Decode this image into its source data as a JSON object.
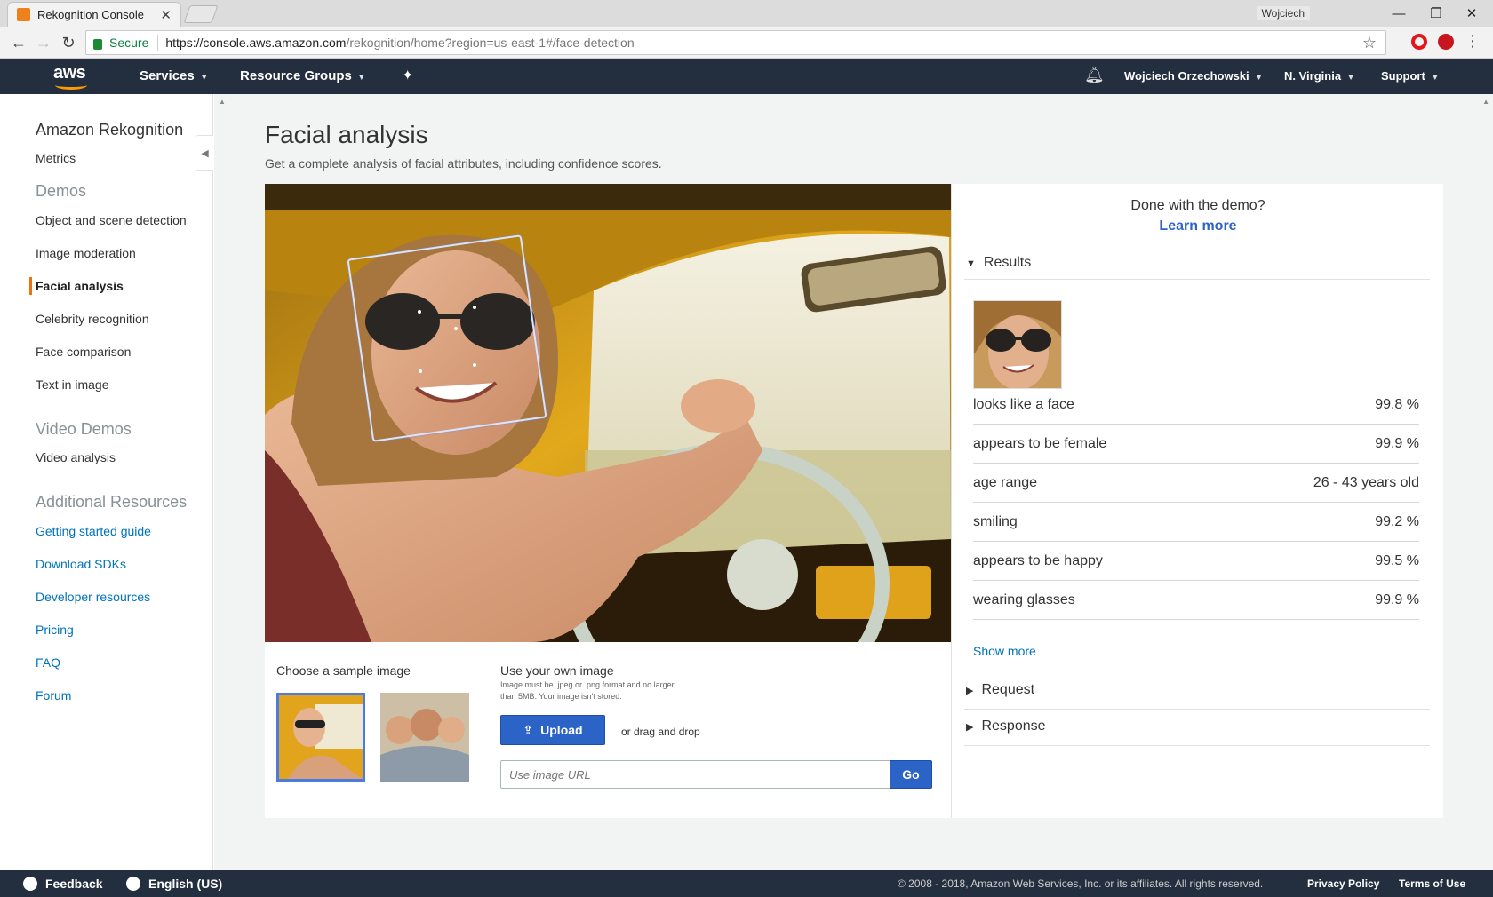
{
  "browser": {
    "tab_title": "Rekognition Console",
    "window_user": "Wojciech",
    "secure_label": "Secure",
    "url_host": "https://console.aws.amazon.com",
    "url_path": "/rekognition/home?region=us-east-1#/face-detection"
  },
  "awsnav": {
    "logo": "aws",
    "services": "Services",
    "resource_groups": "Resource Groups",
    "user": "Wojciech Orzechowski",
    "region": "N. Virginia",
    "support": "Support"
  },
  "sidebar": {
    "title": "Amazon Rekognition",
    "metrics": "Metrics",
    "demos_head": "Demos",
    "demos": [
      "Object and scene detection",
      "Image moderation",
      "Facial analysis",
      "Celebrity recognition",
      "Face comparison",
      "Text in image"
    ],
    "video_head": "Video Demos",
    "video_items": [
      "Video analysis"
    ],
    "resources_head": "Additional Resources",
    "resources": [
      "Getting started guide",
      "Download SDKs",
      "Developer resources",
      "Pricing",
      "FAQ",
      "Forum"
    ]
  },
  "main": {
    "title": "Facial analysis",
    "subtitle": "Get a complete analysis of facial attributes, including confidence scores.",
    "choose_label": "Choose a sample image",
    "own_label": "Use your own image",
    "own_note": "Image must be .jpeg or .png format and no larger than 5MB. Your image isn't stored.",
    "upload_label": "Upload",
    "drag_text": "or drag and drop",
    "url_placeholder": "Use image URL",
    "go_label": "Go"
  },
  "results": {
    "done_text": "Done with the demo?",
    "learn_more": "Learn more",
    "results_head": "Results",
    "attributes": [
      {
        "label": "looks like a face",
        "value": "99.8 %"
      },
      {
        "label": "appears to be female",
        "value": "99.9 %"
      },
      {
        "label": "age range",
        "value": "26 - 43 years old"
      },
      {
        "label": "smiling",
        "value": "99.2 %"
      },
      {
        "label": "appears to be happy",
        "value": "99.5 %"
      },
      {
        "label": "wearing glasses",
        "value": "99.9 %"
      }
    ],
    "show_more": "Show more",
    "request_head": "Request",
    "response_head": "Response"
  },
  "footer": {
    "feedback": "Feedback",
    "language": "English (US)",
    "copyright": "© 2008 - 2018, Amazon Web Services, Inc. or its affiliates. All rights reserved.",
    "privacy": "Privacy Policy",
    "terms": "Terms of Use"
  },
  "colors": {
    "aws_nav": "#232f3e",
    "accent_orange": "#ec7211",
    "button_blue": "#2c63c7",
    "link_blue": "#0073bb"
  }
}
